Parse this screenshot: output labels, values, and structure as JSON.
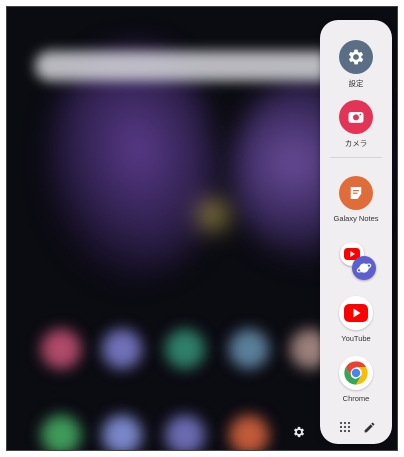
{
  "edge_panel": {
    "apps": [
      {
        "label": "設定",
        "icon": "settings-gear-icon",
        "color": "#5a6f86"
      },
      {
        "label": "カメラ",
        "icon": "camera-icon",
        "color": "#e33357"
      },
      {
        "label": "Galaxy Notes",
        "icon": "notes-icon",
        "color": "#e06c3a"
      },
      {
        "label": "",
        "icon": "app-pair-youtube-internet-icon",
        "color": "#5b5fd0"
      },
      {
        "label": "YouTube",
        "icon": "youtube-icon",
        "color": "#ff0000"
      },
      {
        "label": "Chrome",
        "icon": "chrome-icon",
        "color": "#4285f4"
      }
    ],
    "bottom": {
      "grid_icon": "apps-grid-icon",
      "edit_icon": "edit-pencil-icon"
    }
  },
  "home_screen": {
    "settings_shortcut_icon": "gear-icon"
  }
}
